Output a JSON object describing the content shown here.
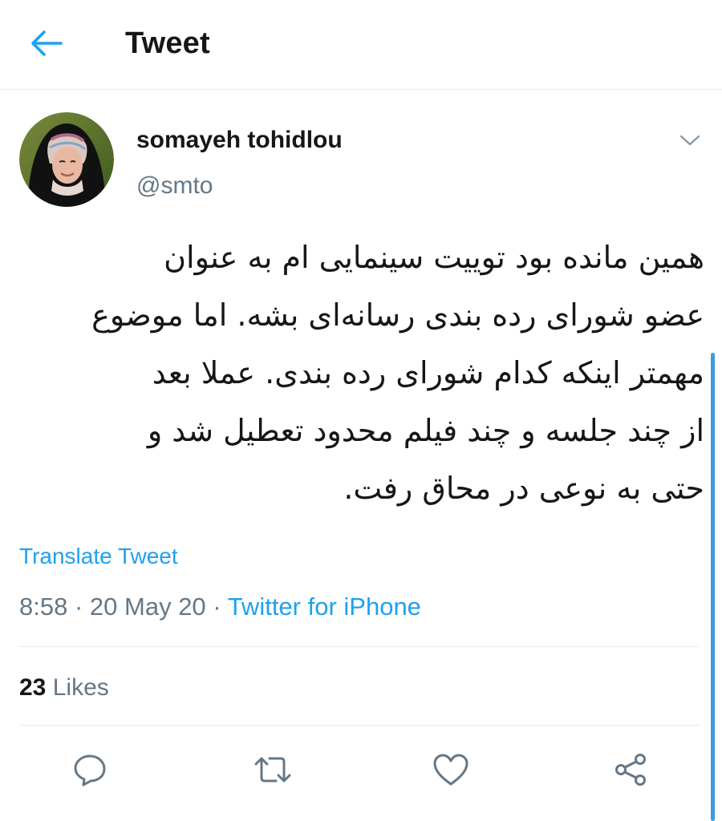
{
  "header": {
    "title": "Tweet"
  },
  "icons": {
    "back": "arrow-left-icon",
    "caret": "chevron-down-icon",
    "reply": "reply-icon",
    "retweet": "retweet-icon",
    "like": "heart-icon",
    "share": "share-icon"
  },
  "author": {
    "display_name": "somayeh tohidlou",
    "handle": "@smto"
  },
  "tweet": {
    "lines": [
      "همین مانده بود توییت سینمایی ام به عنوان",
      "عضو شورای رده بندی رسانه‌ای بشه. اما موضوع",
      "مهمتر اینکه کدام شورای رده بندی. عملا بعد",
      "از چند جلسه و چند فیلم محدود تعطیل شد و",
      "حتی به نوعی در محاق رفت."
    ],
    "translate_label": "Translate Tweet",
    "time": "8:58",
    "separator": "·",
    "date": "20 May 20",
    "source": "Twitter for iPhone"
  },
  "stats": {
    "likes_count": "23",
    "likes_label": "Likes"
  },
  "colors": {
    "accent": "#1da1f2",
    "secondary_text": "#657786",
    "primary_text": "#14171a",
    "divider": "#e6ecf0"
  }
}
